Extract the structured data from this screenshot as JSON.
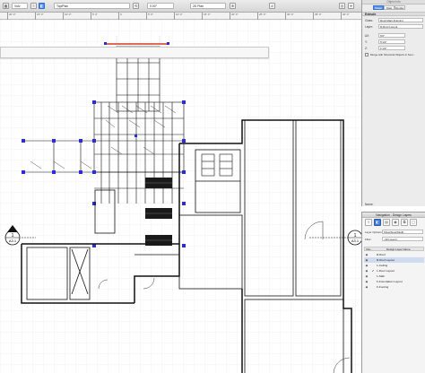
{
  "toolbar": {
    "select_1": "Volv",
    "select_2": "Top/Plan",
    "select_3": "0.00°",
    "select_4": "2D Plan"
  },
  "ruler": {
    "ticks": [
      "20' 0\"",
      "15' 0\"",
      "10' 0\"",
      "5' 0\"",
      "0",
      "5' 0\"",
      "10' 0\"",
      "15' 0\"",
      "20' 0\"",
      "25' 0\"",
      "30' 0\"",
      "35' 0\"",
      "40' 0\""
    ]
  },
  "plan": {
    "marker_left": {
      "number": "1",
      "sheet": "A3.1"
    },
    "marker_right": {
      "number": "1",
      "sheet": "A3.1"
    }
  },
  "object_info": {
    "title": "Object Info",
    "tabs": [
      "Shape",
      "Data",
      "Render"
    ],
    "active_tab": "Shape",
    "object_type": "Extrude",
    "fields": [
      {
        "label": "Class:",
        "value": "Roof-Main-Framing"
      },
      {
        "label": "Layer:",
        "value": "R-Roof Layout"
      },
      {
        "label": "ΔX:",
        "value": "6'0\""
      },
      {
        "label": "Y:",
        "value": "5'1/2\""
      },
      {
        "label": "Z:",
        "value": "1'1/2\""
      }
    ],
    "checkbox_label": "Merge with Structural Objects in Sect...",
    "extra_label": "Name:"
  },
  "navigation": {
    "title": "Navigation - Design Layers",
    "layer_options_label": "Layer Options:",
    "layer_options_value": "Show/Snap/Modif...",
    "filter_label": "Filter:",
    "filter_value": "<All Layers>",
    "columns": {
      "visibility": "Visi...",
      "name": "Design Layer Name"
    },
    "layers": [
      {
        "name": "R-Roof",
        "visible": true,
        "active": false,
        "selected": false
      },
      {
        "name": "R-Roof Layout",
        "visible": true,
        "active": false,
        "selected": true
      },
      {
        "name": "1-Ceiling",
        "visible": true,
        "active": false,
        "selected": false
      },
      {
        "name": "1-Floor Layout",
        "visible": true,
        "active": true,
        "selected": false
      },
      {
        "name": "1-Slab",
        "visible": true,
        "active": false,
        "selected": false
      },
      {
        "name": "F-Foundation Layout",
        "visible": true,
        "active": false,
        "selected": false
      },
      {
        "name": "F-Footing",
        "visible": true,
        "active": false,
        "selected": false
      }
    ]
  },
  "colors": {
    "accent": "#4d8df0",
    "framing_blue": "#2b2bd8",
    "selection_red": "#d23a20",
    "grid": "#e4e4e4"
  }
}
